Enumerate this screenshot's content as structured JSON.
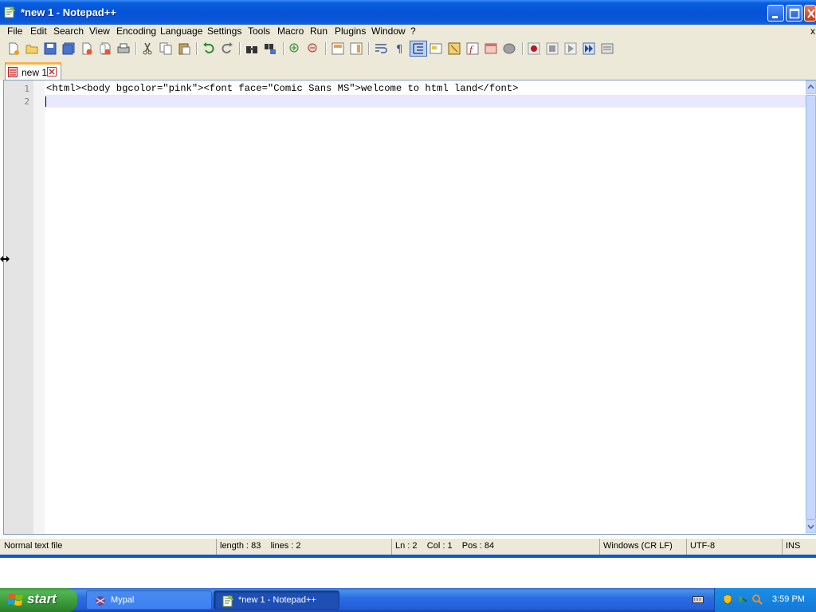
{
  "window": {
    "title": "*new 1 - Notepad++"
  },
  "menu": {
    "items": [
      "File",
      "Edit",
      "Search",
      "View",
      "Encoding",
      "Language",
      "Settings",
      "Tools",
      "Macro",
      "Run",
      "Plugins",
      "Window",
      "?"
    ],
    "close_glyph": "x"
  },
  "toolbar": {
    "icons": [
      "new-file-icon",
      "open-file-icon",
      "save-icon",
      "save-all-icon",
      "close-icon",
      "close-all-icon",
      "print-icon",
      "cut-icon",
      "copy-icon",
      "paste-icon",
      "undo-icon",
      "redo-icon",
      "find-icon",
      "replace-icon",
      "zoom-in-icon",
      "zoom-out-icon",
      "sync-vertical-icon",
      "sync-horizontal-icon",
      "word-wrap-icon",
      "show-all-chars-icon",
      "indent-guide-icon",
      "user-language-icon",
      "document-map-icon",
      "function-list-icon",
      "folder-workspace-icon",
      "monitoring-icon",
      "record-macro-icon",
      "stop-macro-icon",
      "play-macro-icon",
      "run-macro-multiple-icon",
      "save-macro-icon"
    ]
  },
  "tabs": [
    {
      "label": "new 1",
      "modified": true
    }
  ],
  "editor": {
    "line_numbers": [
      "1",
      "2"
    ],
    "lines": [
      "<html><body bgcolor=\"pink\"><font face=\"Comic Sans MS\">welcome to html land</font>",
      ""
    ],
    "current_line": 2
  },
  "statusbar": {
    "file_type": "Normal text file",
    "length": "length : 83",
    "lines": "lines : 2",
    "ln": "Ln : 2",
    "col": "Col : 1",
    "pos": "Pos : 84",
    "eol": "Windows (CR LF)",
    "encoding": "UTF-8",
    "mode": "INS"
  },
  "taskbar": {
    "start_label": "start",
    "tasks": [
      {
        "label": "Mypal",
        "active": false
      },
      {
        "label": "*new 1 - Notepad++",
        "active": true
      }
    ],
    "clock": "3:59 PM"
  },
  "colors": {
    "titlebar": "#0553d6",
    "chrome": "#ece9d8",
    "current_line": "#e8e8ff",
    "tab_accent": "#fab14a",
    "taskbar": "#245edb",
    "start_button": "#3a9a3a"
  }
}
